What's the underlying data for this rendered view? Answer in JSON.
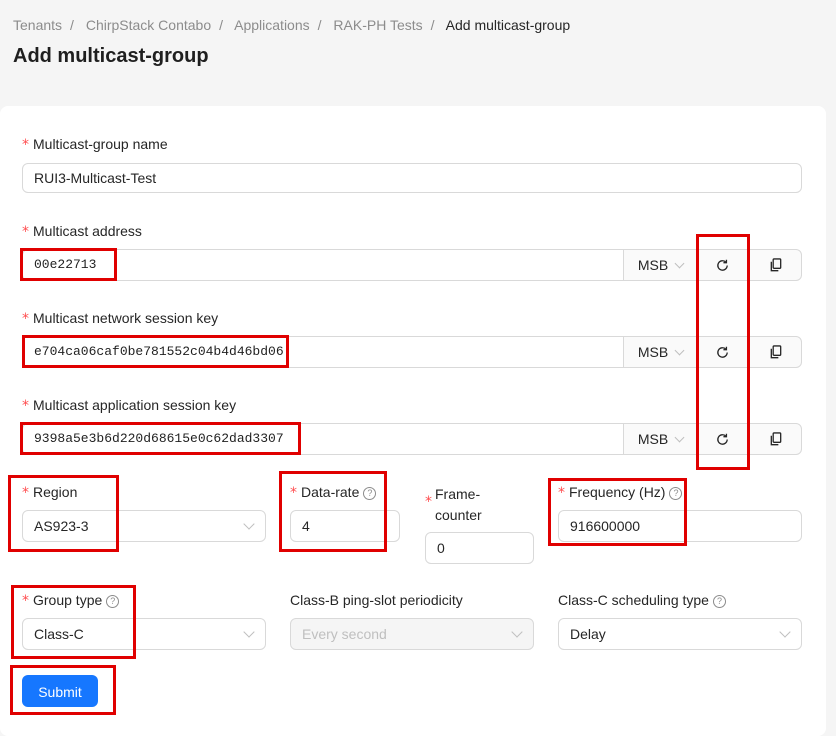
{
  "breadcrumb": [
    "Tenants",
    "ChirpStack Contabo",
    "Applications",
    "RAK-PH Tests",
    "Add multicast-group"
  ],
  "title": "Add multicast-group",
  "required_mark": "*",
  "form": {
    "name": {
      "label": "Multicast-group name",
      "value": "RUI3-Multicast-Test"
    },
    "address": {
      "label": "Multicast address",
      "value": "00e22713",
      "byte_order": "MSB"
    },
    "nwk_key": {
      "label": "Multicast network session key",
      "value": "e704ca06caf0be781552c04b4d46bd06",
      "byte_order": "MSB"
    },
    "app_key": {
      "label": "Multicast application session key",
      "value": "9398a5e3b6d220d68615e0c62dad3307",
      "byte_order": "MSB"
    },
    "region": {
      "label": "Region",
      "value": "AS923-3"
    },
    "data_rate": {
      "label": "Data-rate",
      "value": "4"
    },
    "frame_counter": {
      "label_line1": "Frame-",
      "label_line2": "counter",
      "value": "0"
    },
    "frequency": {
      "label": "Frequency (Hz)",
      "value": "916600000"
    },
    "group_type": {
      "label": "Group type",
      "value": "Class-C"
    },
    "ping_slot": {
      "label": "Class-B ping-slot periodicity",
      "value": "Every second"
    },
    "scheduling": {
      "label": "Class-C scheduling type",
      "value": "Delay"
    },
    "submit": "Submit"
  },
  "icons": {
    "refresh": "refresh-icon",
    "copy": "copy-icon",
    "help": "question-circle-icon"
  },
  "colors": {
    "primary": "#1677ff",
    "required": "#ff4d4f",
    "highlight": "#e00000"
  }
}
